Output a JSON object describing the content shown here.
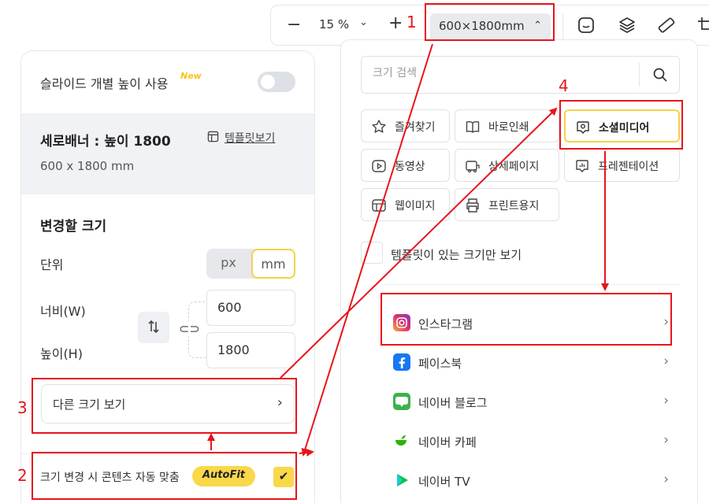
{
  "toolbar": {
    "zoom": "15 %",
    "size": "600×1800mm",
    "minus_label": "−",
    "plus_label": "+"
  },
  "left_panel": {
    "toggle_label": "슬라이드 개별 높이 사용",
    "new_badge": "New",
    "info_title": "세로배너 : 높이 1800",
    "info_sub": "600 x 1800 mm",
    "template_link": "템플릿보기",
    "section_title": "변경할 크기",
    "unit_label": "단위",
    "unit_px": "px",
    "unit_mm": "mm",
    "width_label": "너비(W)",
    "height_label": "높이(H)",
    "width_value": "600",
    "height_value": "1800",
    "other_size": "다른 크기 보기",
    "autofit_label": "크기 변경 시 콘텐츠 자동 맞춤",
    "autofit_badge": "AutoFit"
  },
  "dropdown": {
    "search_placeholder": "크기 검색",
    "categories": [
      {
        "label": "즐겨찾기",
        "icon": "star-icon"
      },
      {
        "label": "바로인쇄",
        "icon": "book-icon"
      },
      {
        "label": "소셜미디어",
        "icon": "social-icon",
        "active": true
      },
      {
        "label": "동영상",
        "icon": "play-icon"
      },
      {
        "label": "상세페이지",
        "icon": "detail-page-icon"
      },
      {
        "label": "프레젠테이션",
        "icon": "presentation-icon"
      },
      {
        "label": "웹이미지",
        "icon": "web-image-icon"
      },
      {
        "label": "프린트용지",
        "icon": "printer-icon"
      }
    ],
    "template_only": "템플릿이 있는 크기만 보기",
    "social_items": [
      {
        "label": "인스타그램",
        "icon": "instagram-icon"
      },
      {
        "label": "페이스북",
        "icon": "facebook-icon"
      },
      {
        "label": "네이버 블로그",
        "icon": "naver-blog-icon"
      },
      {
        "label": "네이버 카페",
        "icon": "naver-cafe-icon"
      },
      {
        "label": "네이버 TV",
        "icon": "naver-tv-icon"
      }
    ]
  },
  "annotations": {
    "n1": "1",
    "n2": "2",
    "n3": "3",
    "n4": "4"
  },
  "colors": {
    "accent_yellow": "#f9d84a",
    "annotation_red": "#e8141a"
  }
}
